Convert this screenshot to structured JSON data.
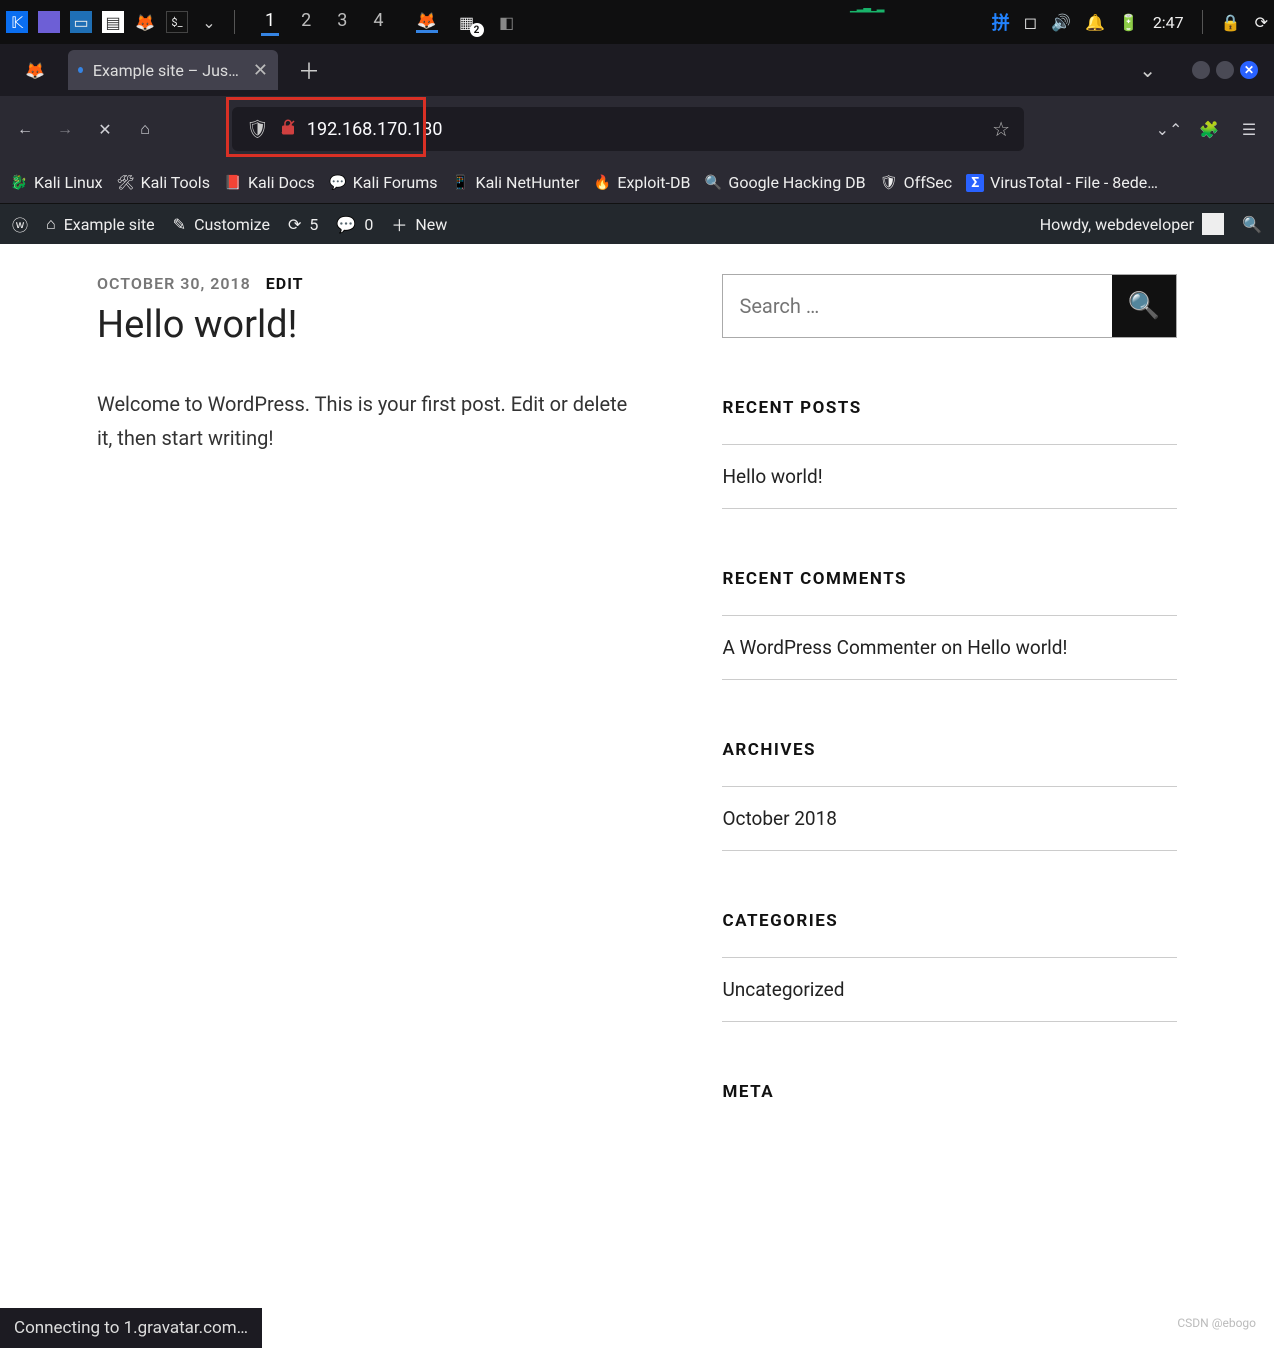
{
  "sysbar": {
    "workspaces": [
      "1",
      "2",
      "3",
      "4"
    ],
    "active_workspace": 0,
    "badge": "2",
    "time": "2:47",
    "ime": "拼"
  },
  "browser": {
    "tab_title": "Example site – Just anoth",
    "url": "192.168.170.130",
    "bookmarks": [
      {
        "icon": "🐉",
        "label": "Kali Linux"
      },
      {
        "icon": "🛠",
        "label": "Kali Tools"
      },
      {
        "icon": "📕",
        "label": "Kali Docs"
      },
      {
        "icon": "💬",
        "label": "Kali Forums"
      },
      {
        "icon": "📱",
        "label": "Kali NetHunter"
      },
      {
        "icon": "🔥",
        "label": "Exploit-DB"
      },
      {
        "icon": "🔍",
        "label": "Google Hacking DB"
      },
      {
        "icon": "🛡",
        "label": "OffSec"
      },
      {
        "icon": "Σ",
        "label": "VirusTotal - File - 8ede…"
      }
    ],
    "status": "Connecting to 1.gravatar.com…"
  },
  "wpbar": {
    "site": "Example site",
    "customize": "Customize",
    "updates": "5",
    "comments": "0",
    "new": "New",
    "howdy": "Howdy, webdeveloper"
  },
  "post": {
    "date": "OCTOBER 30, 2018",
    "edit": "EDIT",
    "title": "Hello world!",
    "body": "Welcome to WordPress. This is your first post. Edit or delete it, then start writing!"
  },
  "sidebar": {
    "search_placeholder": "Search …",
    "recent_posts": {
      "title": "RECENT POSTS",
      "items": [
        "Hello world!"
      ]
    },
    "recent_comments": {
      "title": "RECENT COMMENTS",
      "items": [
        {
          "author": "A WordPress Commenter",
          "on": " on ",
          "post": "Hello world!"
        }
      ]
    },
    "archives": {
      "title": "ARCHIVES",
      "items": [
        "October 2018"
      ]
    },
    "categories": {
      "title": "CATEGORIES",
      "items": [
        "Uncategorized"
      ]
    },
    "meta": {
      "title": "META"
    }
  },
  "watermark": "CSDN @ebogo"
}
